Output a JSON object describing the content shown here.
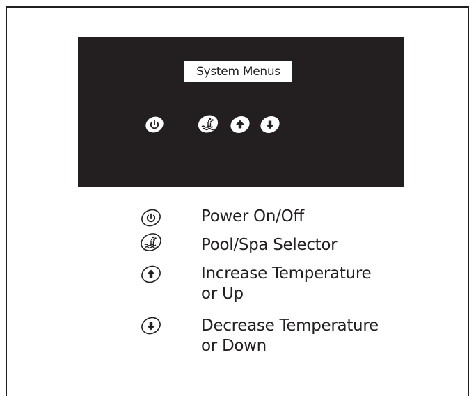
{
  "display": {
    "text": "System Menus"
  },
  "keys": [
    {
      "icon": "power-icon"
    },
    {
      "icon": "pool-spa-icon"
    },
    {
      "icon": "up-arrow-icon"
    },
    {
      "icon": "down-arrow-icon"
    }
  ],
  "legend": [
    {
      "icon": "power-icon",
      "lines": [
        "Power On/Off"
      ]
    },
    {
      "icon": "pool-spa-icon",
      "lines": [
        "Pool/Spa Selector"
      ]
    },
    {
      "icon": "up-arrow-icon",
      "lines": [
        "Increase Temperature",
        "or Up"
      ]
    },
    {
      "icon": "down-arrow-icon",
      "lines": [
        "Decrease Temperature",
        "or Down"
      ]
    }
  ],
  "colors": {
    "panel": "#231f20",
    "line": "#231f20",
    "background": "#ffffff"
  }
}
